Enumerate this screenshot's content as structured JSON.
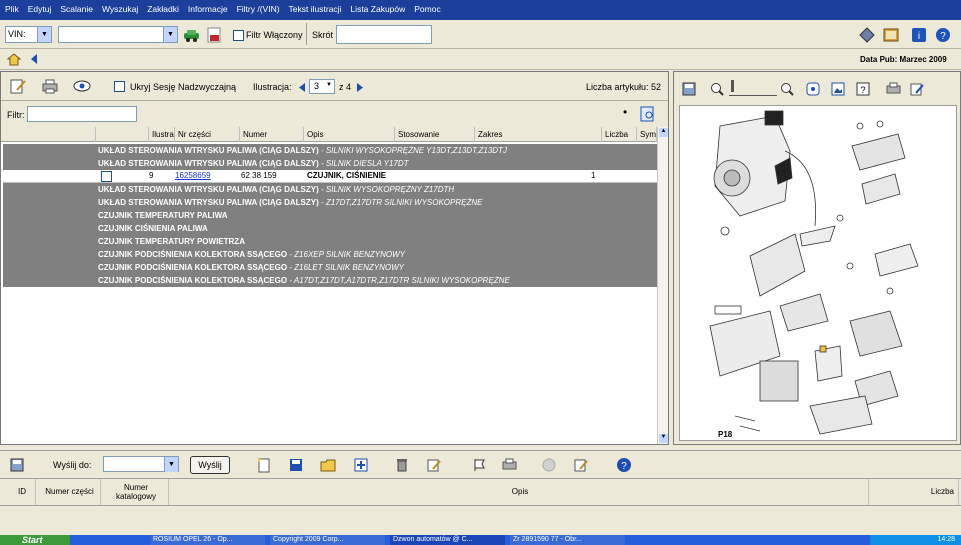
{
  "menu": [
    "Plik",
    "Edytuj",
    "Scalanie",
    "Wyszukaj",
    "Zakładki",
    "Informacje",
    "Filtry /(VIN)",
    "Tekst ilustracji",
    "Lista Zakupów",
    "Pomoc"
  ],
  "toolbar1": {
    "vin_value": "VIN:",
    "filter_label": "Filtr Włączony",
    "shortcut_label": "Skrót",
    "shortcut_value": ""
  },
  "status": {
    "data_pub": "Data Pub: Marzec 2009"
  },
  "left_toolbar": {
    "hide_session_label": "Ukryj Sesję Nadzwyczajną",
    "illustration_label": "Ilustracja:",
    "illustration_value": "3",
    "illustration_of": "z 4",
    "article_count": "Liczba artykułu: 52"
  },
  "filter": {
    "label": "Filtr:",
    "value": ""
  },
  "table": {
    "headers": [
      "",
      "",
      "Ilustra",
      "Nr części",
      "Numer",
      "Opis",
      "Stosowanie",
      "Zakres",
      "Liczba",
      "Sym"
    ],
    "rows": [
      {
        "type": "group",
        "main": "UKŁAD STEROWANIA WTRYSKU PALIWA (CIĄG DALSZY)",
        "sub": " - SILNIKI WYSOKOPRĘŻNE Y13DT,Z13DT,Z13DTJ"
      },
      {
        "type": "group",
        "main": "UKŁAD STEROWANIA WTRYSKU PALIWA (CIĄG DALSZY)",
        "sub": " - SILNIK DIESLA Y17DT"
      },
      {
        "type": "item",
        "illus": "9",
        "part": "16258659",
        "number": "62 38 159",
        "desc": "CZUJNIK, CIŚNIENIE",
        "qty": "1"
      },
      {
        "type": "group",
        "main": "UKŁAD STEROWANIA WTRYSKU PALIWA (CIĄG DALSZY)",
        "sub": " - SILNIK WYSOKOPRĘŻNY Z17DTH"
      },
      {
        "type": "group",
        "main": "UKŁAD STEROWANIA WTRYSKU PALIWA (CIĄG DALSZY)",
        "sub": " - Z17DT,Z17DTR SILNIKI WYSOKOPRĘŻNE"
      },
      {
        "type": "group",
        "main": "CZUJNIK TEMPERATURY PALIWA",
        "sub": ""
      },
      {
        "type": "group",
        "main": "CZUJNIK CIŚNIENIA PALIWA",
        "sub": ""
      },
      {
        "type": "group",
        "main": "CZUJNIK TEMPERATURY POWIETRZA",
        "sub": ""
      },
      {
        "type": "group",
        "main": "CZUJNIK PODCIŚNIENIA KOLEKTORA SSĄCEGO",
        "sub": " - Z16XEP SILNIK BENZYNOWY"
      },
      {
        "type": "group",
        "main": "CZUJNIK PODCIŚNIENIA KOLEKTORA SSĄCEGO",
        "sub": " - Z16LET SILNIK BENZYNOWY"
      },
      {
        "type": "group",
        "main": "CZUJNIK PODCIŚNIENIA KOLEKTORA SSĄCEGO",
        "sub": " - A17DT,Z17DT,A17DTR,Z17DTR SILNIKI WYSOKOPRĘŻNE"
      }
    ]
  },
  "illustration": {
    "code": "P18"
  },
  "bottom": {
    "send_to_label": "Wyślij do:",
    "send_button": "Wyślij",
    "columns": [
      "ID",
      "Numer części",
      "Numer katalogowy",
      "Opis",
      "Liczba"
    ]
  },
  "taskbar": {
    "start": "Start",
    "tasks": [
      "ROSIUM OPEL 26 - Op...",
      "Copyright 2009 Corp...",
      "Dzwon automatów @ C...",
      "Zr 2891590 77 - Obr..."
    ],
    "clock": "14:28"
  },
  "colors": {
    "menubar": "#1b3f9a",
    "group_row": "#808080",
    "item_row": "#ffffff",
    "panel_bg": "#ece9d8"
  }
}
